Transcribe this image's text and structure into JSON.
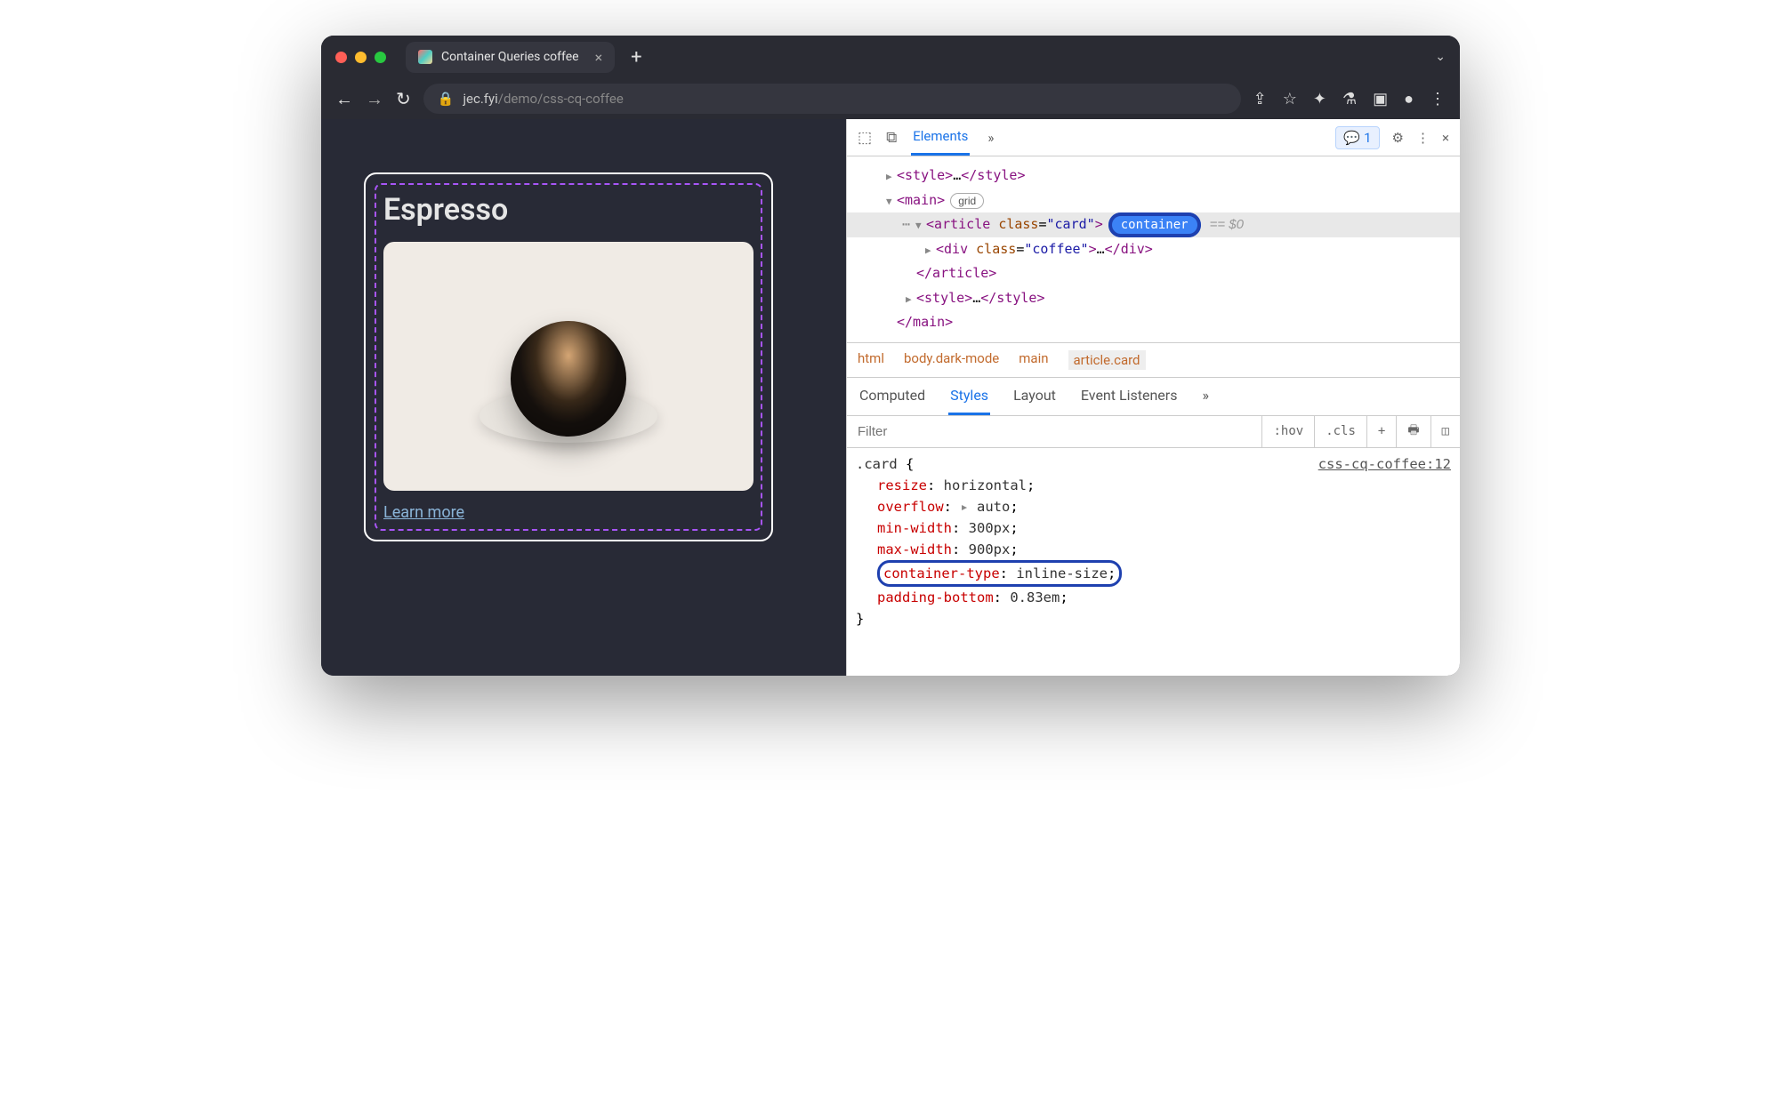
{
  "titlebar": {
    "tab_title": "Container Queries coffee",
    "close_glyph": "×",
    "newtab_glyph": "+",
    "menu_glyph": "⌄"
  },
  "addrbar": {
    "back": "←",
    "fwd": "→",
    "reload": "↻",
    "lock": "🔒",
    "url_host": "jec.fyi",
    "url_path": "/demo/css-cq-coffee",
    "share": "⇪",
    "star": "☆",
    "ext": "✦",
    "flask": "⚗",
    "panel": "▣",
    "account": "●",
    "more": "⋮"
  },
  "page": {
    "heading": "Espresso",
    "link": "Learn more"
  },
  "devtools": {
    "inspect": "⬚",
    "device": "⧉",
    "tab_elements": "Elements",
    "more_tabs": "»",
    "msg_count": "1",
    "gear": "⚙",
    "kebab": "⋮",
    "close": "×"
  },
  "dom": {
    "line1_open": "<style>",
    "line1_ell": "…",
    "line1_close": "</style>",
    "line2": "<main>",
    "badge_grid": "grid",
    "line3_a": "<article ",
    "line3_attr": "class",
    "line3_val": "\"card\"",
    "line3_b": ">",
    "badge_container": "container",
    "eq0": "== $0",
    "line4_a": "<div ",
    "line4_attr": "class",
    "line4_val": "\"coffee\"",
    "line4_b": ">",
    "line4_ell": "…",
    "line4_c": "</div>",
    "line5": "</article>",
    "line6_open": "<style>",
    "line6_ell": "…",
    "line6_close": "</style>",
    "line7": "</main>"
  },
  "breadcrumb": {
    "b1": "html",
    "b2": "body.dark-mode",
    "b3": "main",
    "b4": "article.card"
  },
  "subtabs": {
    "computed": "Computed",
    "styles": "Styles",
    "layout": "Layout",
    "events": "Event Listeners",
    "more": "»"
  },
  "filterbar": {
    "placeholder": "Filter",
    "hov": ":hov",
    "cls": ".cls",
    "plus": "+",
    "pin": "🖶",
    "panel": "◫"
  },
  "styles": {
    "src": "css-cq-coffee:12",
    "selector": ".card",
    "open": " {",
    "p1": "resize",
    "v1": "horizontal",
    "p2": "overflow",
    "v2": "auto",
    "p3": "min-width",
    "v3": "300px",
    "p4": "max-width",
    "v4": "900px",
    "p5": "container-type",
    "v5": "inline-size",
    "p6": "padding-bottom",
    "v6": "0.83em",
    "close": "}",
    "arrow": "▸"
  }
}
